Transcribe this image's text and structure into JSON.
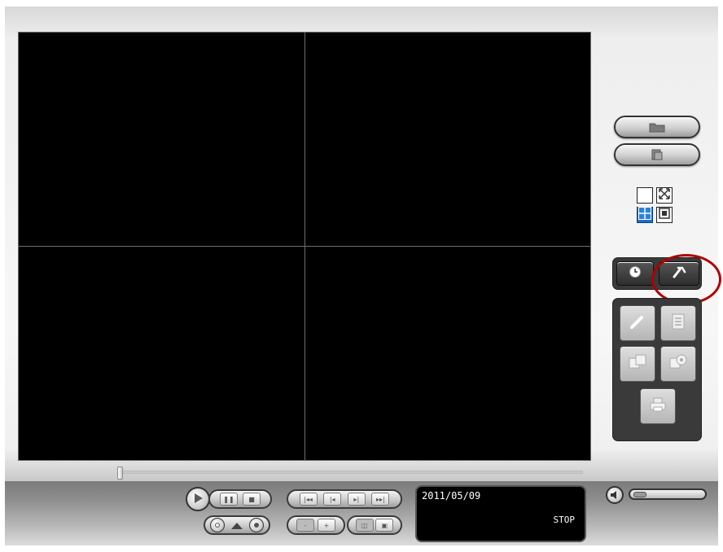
{
  "app": {
    "title": "",
    "accent_color": "#1c6fc4",
    "highlight_color": "#b00000"
  },
  "video": {
    "layout": "2x2",
    "channels": [
      "",
      "",
      "",
      ""
    ]
  },
  "side_panel": {
    "buttons": [
      {
        "name": "open-folder",
        "icon": "folder-icon"
      },
      {
        "name": "export",
        "icon": "export-icon"
      }
    ],
    "layouts": [
      {
        "name": "single-view",
        "icon": "square-icon"
      },
      {
        "name": "full-screen",
        "icon": "fullscreen-icon"
      },
      {
        "name": "quad-view",
        "icon": "quad-icon"
      },
      {
        "name": "fit-view",
        "icon": "fit-icon"
      }
    ],
    "mode_buttons": [
      {
        "name": "schedule",
        "icon": "clock-icon"
      },
      {
        "name": "setup",
        "icon": "wrench-icon",
        "highlighted": true
      }
    ],
    "tools": [
      {
        "name": "edit",
        "icon": "pen-icon"
      },
      {
        "name": "list",
        "icon": "list-icon"
      },
      {
        "name": "save",
        "icon": "save-icon"
      },
      {
        "name": "save-alt",
        "icon": "disk-icon"
      },
      {
        "name": "print",
        "icon": "print-icon"
      }
    ]
  },
  "playback": {
    "status_date": "2011/05/09",
    "status_state": "STOP",
    "seek_position": 0.0,
    "volume_level": 0.1,
    "zoom_minus": "-",
    "zoom_plus": "+"
  }
}
